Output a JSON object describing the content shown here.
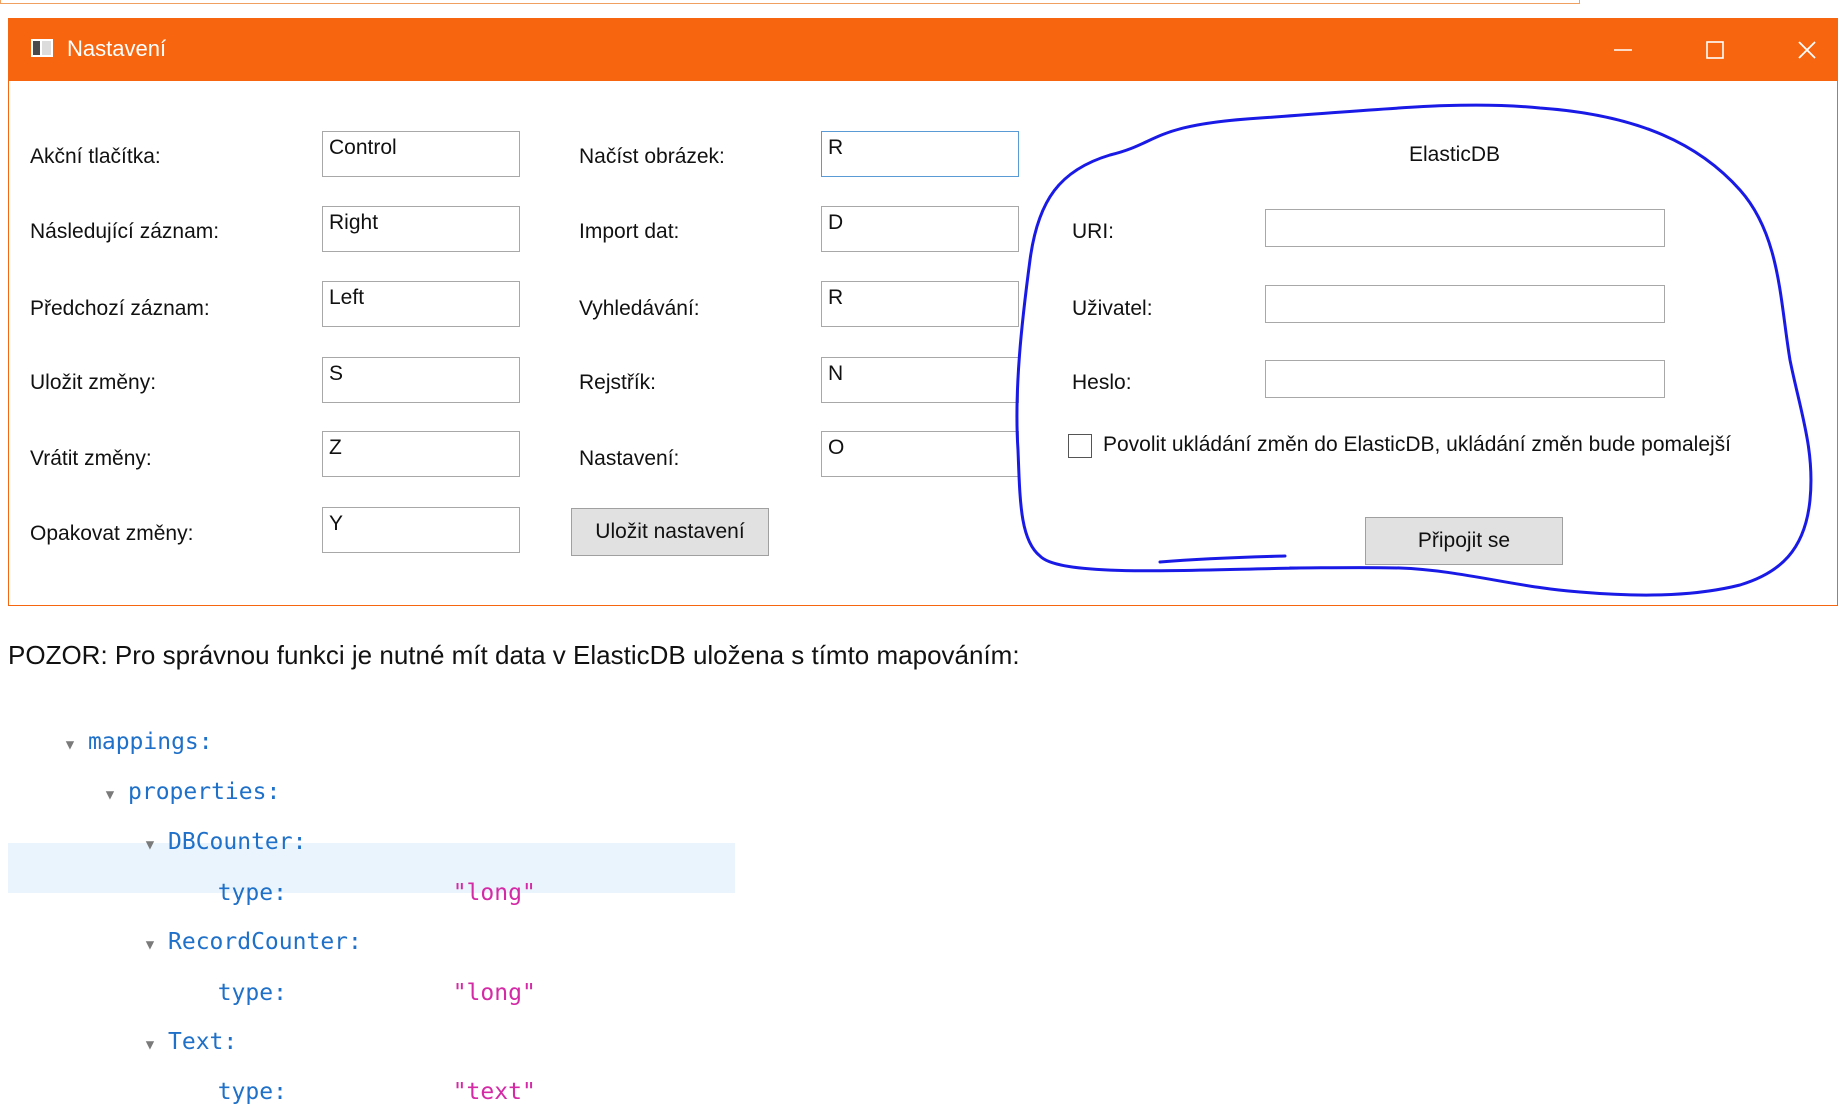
{
  "window": {
    "title": "Nastavení",
    "accent_color": "#f7650e",
    "controls": {
      "minimize_icon": "minimize-icon",
      "maximize_icon": "maximize-icon",
      "close_icon": "close-icon"
    }
  },
  "shortcuts_left": [
    {
      "label": "Akční tlačítka:",
      "value": "Control"
    },
    {
      "label": "Následující záznam:",
      "value": "Right"
    },
    {
      "label": "Předchozí záznam:",
      "value": "Left"
    },
    {
      "label": "Uložit změny:",
      "value": "S"
    },
    {
      "label": "Vrátit změny:",
      "value": "Z"
    },
    {
      "label": "Opakovat změny:",
      "value": "Y"
    }
  ],
  "shortcuts_right": [
    {
      "label": "Načíst obrázek:",
      "value": "R"
    },
    {
      "label": "Import dat:",
      "value": "D"
    },
    {
      "label": "Vyhledávání:",
      "value": "R"
    },
    {
      "label": "Rejstřík:",
      "value": "N"
    },
    {
      "label": "Nastavení:",
      "value": "O"
    }
  ],
  "save_button": "Uložit nastavení",
  "elastic": {
    "heading": "ElasticDB",
    "uri_label": "URI:",
    "uri_value": "",
    "user_label": "Uživatel:",
    "user_value": "",
    "password_label": "Heslo:",
    "password_value": "",
    "checkbox_label": "Povolit ukládání změn do ElasticDB, ukládání změn bude pomalejší",
    "checkbox_checked": false,
    "connect_button": "Připojit se",
    "annotation_color": "#1a1ae6"
  },
  "note": "POZOR: Pro správnou funkci je nutné mít data v ElasticDB uložena s tímto mapováním:",
  "mapping_tree": {
    "root": "mappings:",
    "properties": "properties:",
    "fields": [
      {
        "name": "DBCounter:",
        "type_key": "type:",
        "type_value": "\"long\""
      },
      {
        "name": "RecordCounter:",
        "type_key": "type:",
        "type_value": "\"long\""
      },
      {
        "name": "Text:",
        "type_key": "type:",
        "type_value": "\"text\""
      }
    ]
  }
}
